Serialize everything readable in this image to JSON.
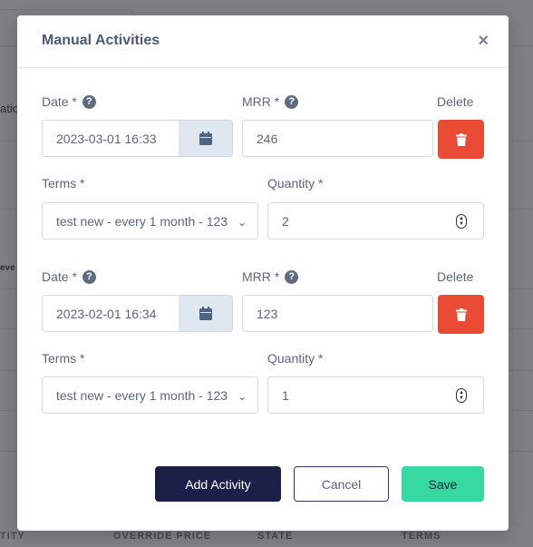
{
  "background": {
    "partial_texts": [
      "atio",
      "eve"
    ],
    "table_headers": [
      "TITY",
      "OVERRIDE PRICE",
      "STATE",
      "TERMS"
    ]
  },
  "modal": {
    "title": "Manual Activities",
    "close_glyph": "×",
    "activities": [
      {
        "date_label": "Date *",
        "date_value": "2023-03-01 16:33",
        "mrr_label": "MRR *",
        "mrr_value": "246",
        "delete_label": "Delete",
        "terms_label": "Terms *",
        "terms_value": "test new - every 1 month - 123",
        "quantity_label": "Quantity *",
        "quantity_value": "2"
      },
      {
        "date_label": "Date *",
        "date_value": "2023-02-01 16:34",
        "mrr_label": "MRR *",
        "mrr_value": "123",
        "delete_label": "Delete",
        "terms_label": "Terms *",
        "terms_value": "test new - every 1 month - 123",
        "quantity_label": "Quantity *",
        "quantity_value": "1"
      }
    ],
    "buttons": {
      "add_activity": "Add Activity",
      "cancel": "Cancel",
      "save": "Save"
    }
  },
  "icons": {
    "help": "question-circle-icon",
    "calendar": "calendar-icon",
    "delete": "trash-icon",
    "close": "close-icon"
  },
  "colors": {
    "delete_button": "#ea4b35",
    "add_button": "#1c2048",
    "save_button": "#37d9a0",
    "calendar_button": "#dfe7f1"
  }
}
